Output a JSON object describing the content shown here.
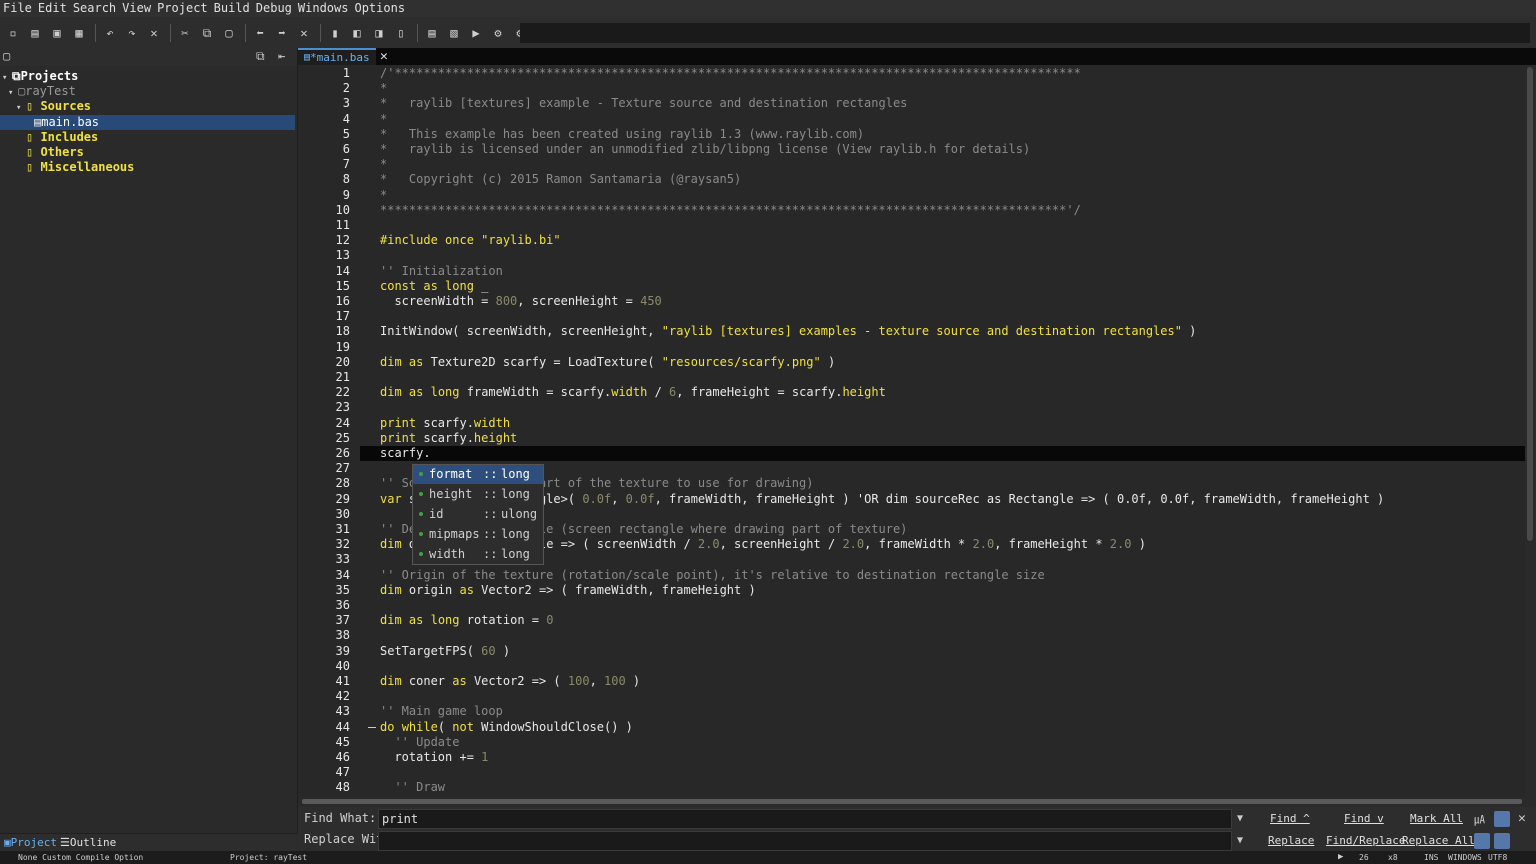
{
  "menu": [
    "File",
    "Edit",
    "Search",
    "View",
    "Project",
    "Build",
    "Debug",
    "Windows",
    "Options"
  ],
  "sidebar": {
    "tree": {
      "root": "Projects",
      "project": "rayTest",
      "sources": "Sources",
      "file": "main.bas",
      "includes": "Includes",
      "others": "Others",
      "misc": "Miscellaneous"
    },
    "tabs": {
      "project": "Project",
      "outline": "Outline"
    }
  },
  "tab": {
    "label": "*main.bas"
  },
  "editor": {
    "lines": [
      "/'***********************************************************************************************",
      "*",
      "*   raylib [textures] example - Texture source and destination rectangles",
      "*",
      "*   This example has been created using raylib 1.3 (www.raylib.com)",
      "*   raylib is licensed under an unmodified zlib/libpng license (View raylib.h for details)",
      "*",
      "*   Copyright (c) 2015 Ramon Santamaria (@raysan5)",
      "*",
      "***********************************************************************************************'/",
      "",
      "#include once \"raylib.bi\"",
      "",
      "'' Initialization",
      "const as long _",
      "  screenWidth = 800, screenHeight = 450",
      "",
      "InitWindow( screenWidth, screenHeight, \"raylib [textures] examples - texture source and destination rectangles\" )",
      "",
      "dim as Texture2D scarfy = LoadTexture( \"resources/scarfy.png\" )",
      "",
      "dim as long frameWidth = scarfy.width / 6, frameHeight = scarfy.height",
      "",
      "print scarfy.width",
      "print scarfy.height",
      "scarfy.",
      "",
      "'' Source rectangle (part of the texture to use for drawing)",
      "var sourceRec = Rectangle>( 0.0f, 0.0f, frameWidth, frameHeight ) 'OR dim sourceRec as Rectangle => ( 0.0f, 0.0f, frameWidth, frameHeight )",
      "",
      "'' Destination rectangle (screen rectangle where drawing part of texture)",
      "dim destRec as Rectangle => ( screenWidth / 2.0, screenHeight / 2.0, frameWidth * 2.0, frameHeight * 2.0 )",
      "",
      "'' Origin of the texture (rotation/scale point), it's relative to destination rectangle size",
      "dim origin as Vector2 => ( frameWidth, frameHeight )",
      "",
      "dim as long rotation = 0",
      "",
      "SetTargetFPS( 60 )",
      "",
      "dim coner as Vector2 => ( 100, 100 )",
      "",
      "'' Main game loop",
      "do while( not WindowShouldClose() )",
      "  '' Update",
      "  rotation += 1",
      "",
      "  '' Draw"
    ],
    "current_line": 26
  },
  "autocomplete": [
    {
      "name": "format",
      "type": "long"
    },
    {
      "name": "height",
      "type": "long"
    },
    {
      "name": "id",
      "type": "ulong"
    },
    {
      "name": "mipmaps",
      "type": "long"
    },
    {
      "name": "width",
      "type": "long"
    }
  ],
  "find": {
    "find_label": "Find What:",
    "find_value": "print",
    "replace_label": "Replace With:",
    "replace_value": "",
    "find_prev": "Find ^",
    "find_next": "Find v",
    "mark_all": "Mark All",
    "replace": "Replace",
    "find_replace": "Find/Replace",
    "replace_all": "Replace All"
  },
  "status": {
    "left": "None Custom Compile Option",
    "project": "Project: rayTest",
    "line": "26",
    "col": "x8",
    "mode": "INS",
    "eol": "WINDOWS",
    "enc": "UTF8"
  }
}
